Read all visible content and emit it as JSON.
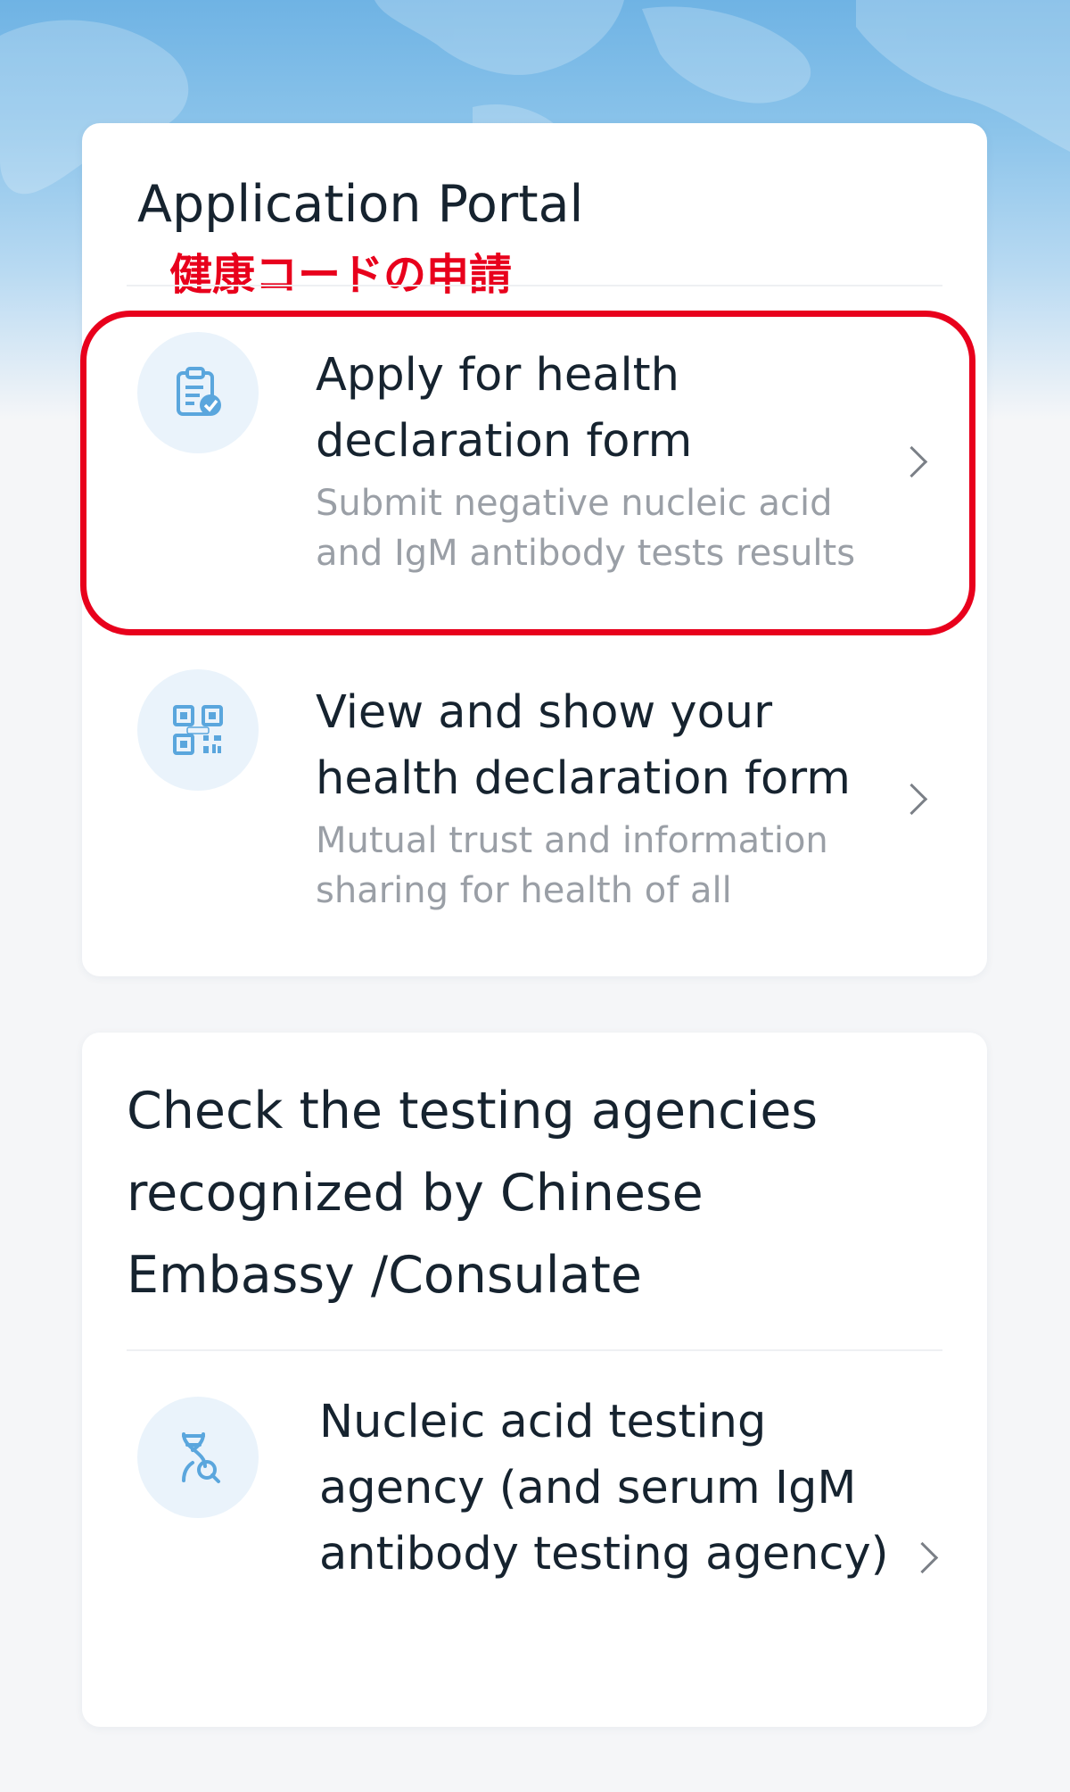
{
  "card_portal": {
    "title": "Application Portal",
    "annotation_label": "健康コードの申請",
    "items": [
      {
        "title": "Apply for health declaration form",
        "subtitle": "Submit negative nucleic acid and IgM antibody tests results",
        "icon": "clipboard-check-icon"
      },
      {
        "title": "View and show your health declaration form",
        "subtitle": "Mutual trust and information sharing for health of all",
        "icon": "qr-code-icon"
      }
    ]
  },
  "card_agencies": {
    "title": "Check the testing agencies recognized by Chinese Embassy /Consulate",
    "items": [
      {
        "title": "Nucleic acid testing agency (and serum IgM antibody testing agency)",
        "icon": "dna-search-icon"
      }
    ]
  },
  "colors": {
    "accent": "#3a9bdc",
    "annotation": "#e8001c",
    "icon_bg": "#eaf3fb",
    "title_text": "#16232f",
    "subtitle_text": "#9a9fa6"
  }
}
